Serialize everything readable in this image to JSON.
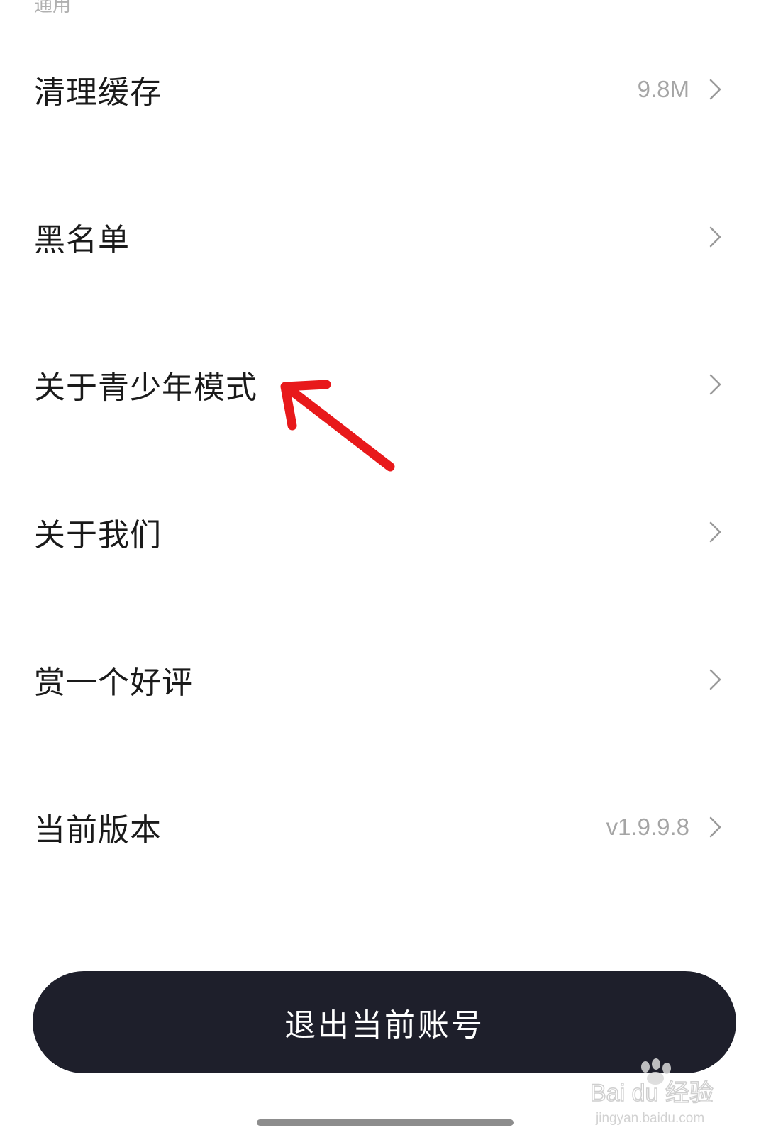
{
  "section": {
    "title": "通用"
  },
  "settings": {
    "items": [
      {
        "label": "清理缓存",
        "value": "9.8M"
      },
      {
        "label": "黑名单",
        "value": ""
      },
      {
        "label": "关于青少年模式",
        "value": ""
      },
      {
        "label": "关于我们",
        "value": ""
      },
      {
        "label": "赏一个好评",
        "value": ""
      },
      {
        "label": "当前版本",
        "value": "v1.9.9.8"
      }
    ]
  },
  "actions": {
    "logout_label": "退出当前账号"
  },
  "watermark": {
    "brand": "Bai du 经验",
    "url": "jingyan.baidu.com"
  },
  "colors": {
    "annotation_arrow": "#e8191b",
    "button_background": "#1e1f2b"
  },
  "icons": {
    "chevron": "chevron-right-icon",
    "annotation": "red-arrow-annotation"
  }
}
